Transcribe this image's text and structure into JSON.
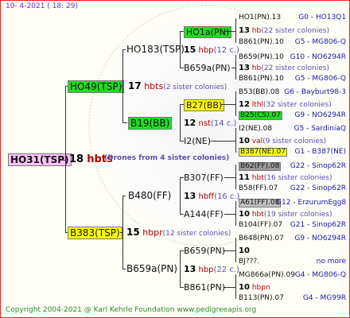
{
  "header": {
    "date": "10-  4-2021 ( 18: 29)"
  },
  "footer": {
    "copyright": "Copyright 2004-2021 @ Karl Kehrle Foundation    www.pedigreeapis.org"
  },
  "root": {
    "name": "HO31(TSP)",
    "num": "18",
    "hb": "hbts",
    "extra": "(Drones from 4 sister colonies)"
  },
  "gen1": [
    {
      "name": "HO49(TSP)",
      "num": "17",
      "hb": "hbts",
      "extra": "(2 sister colonies)",
      "color": "#22dd22"
    },
    {
      "name": "B383(TSP)",
      "num": "15",
      "hb": "hbpr",
      "extra": "(12 sister colonies)",
      "color": "#ffff00"
    }
  ],
  "gen2": [
    {
      "name": "HO183(TSP)",
      "num": "15",
      "hb": "hbp",
      "extra": "(12 c.)"
    },
    {
      "name": "B19(BB)",
      "num": "12",
      "hb": "nst",
      "extra": "(14 c.)",
      "color": "#22dd22"
    },
    {
      "name": "B480(FF)",
      "num": "13",
      "hb": "hbff",
      "extra": "(16 c.)"
    },
    {
      "name": "B659a(PN)",
      "num": "13",
      "hb": "hbp",
      "extra": "(22 c.)"
    }
  ],
  "gen3": [
    {
      "name": "HO1a(PN)",
      "color": "#22dd22"
    },
    {
      "name": "B659a(PN)"
    },
    {
      "name": "B27(BB)",
      "color": "#ffff00"
    },
    {
      "name": "I2(NE)"
    },
    {
      "name": "B307(FF)"
    },
    {
      "name": "A144(FF)"
    },
    {
      "name": "B659(PN)"
    },
    {
      "name": "B861(PN)"
    }
  ],
  "gen4": [
    {
      "name": "HO1(PN).13",
      "meta": "G0 - HO13Q1"
    },
    {
      "num": "13",
      "hb": "hb",
      "extra": "(22 sister colonies)"
    },
    {
      "name": "B861(PN).10",
      "meta": "G5 - MG806-Q"
    },
    {
      "name": "B659(PN).10",
      "meta": "G10 - NO6294R"
    },
    {
      "num": "13",
      "hb": "hb",
      "extra": "(22 sister colonies)"
    },
    {
      "name": "B861(PN).10",
      "meta": "G5 - MG806-Q"
    },
    {
      "name": "B53(BB).08",
      "meta": "G6 - Bayburt98-3"
    },
    {
      "num": "12",
      "hb": "lthl",
      "extra": "(32 sister colonies)"
    },
    {
      "name": "B25(CS).07",
      "meta": "G9 - NO6294R",
      "color": "#22dd22"
    },
    {
      "name": "I2(NE).08",
      "meta": "G5 - SardiniaQ"
    },
    {
      "num": "10",
      "hb": "val",
      "extra": "(9 sister colonies)"
    },
    {
      "name": "B387(NE).07",
      "meta": "G1 - B387(NE)",
      "color": "#ffff00"
    },
    {
      "name": "B62(FF).08",
      "meta": "G22 - Sinop62R",
      "color": "#9a9a9a"
    },
    {
      "num": "11",
      "hb": "hbt",
      "extra": "(16 sister colonies)"
    },
    {
      "name": "B58(FF).07",
      "meta": "G22 - Sinop62R"
    },
    {
      "name": "A61(FF).08",
      "meta": "G12 - ErzurumEgg8",
      "color": "#c0c0c0"
    },
    {
      "num": "10",
      "hb": "hbt",
      "extra": "(19 sister colonies)"
    },
    {
      "name": "B104(FF).07",
      "meta": "G21 - Sinop62R"
    },
    {
      "name": "B648(PN).07",
      "meta": "G9 - NO6294R"
    },
    {
      "num": "10",
      "hb": "",
      "extra": ""
    },
    {
      "name": "BJ???.",
      "meta": "no more"
    },
    {
      "name": "MG866a(PN).09",
      "meta": "G4 - MG806-Q"
    },
    {
      "num": "10",
      "hb": "hbpn",
      "extra": ""
    },
    {
      "name": "B113(PN).07",
      "meta": "G4 - MG99R"
    }
  ]
}
